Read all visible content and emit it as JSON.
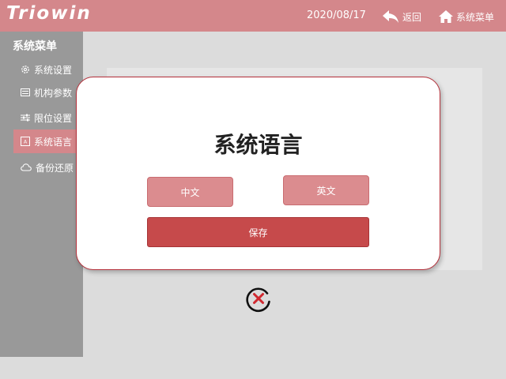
{
  "header": {
    "logo": "Triowin",
    "date": "2020/08/17",
    "back_label": "返回",
    "menu_label": "系统菜单"
  },
  "sidebar": {
    "title": "系统菜单",
    "items": [
      {
        "label": "系统设置",
        "icon": "gear-icon"
      },
      {
        "label": "机构参数",
        "icon": "list-icon"
      },
      {
        "label": "限位设置",
        "icon": "sliders-icon"
      },
      {
        "label": "系统语言",
        "icon": "language-icon",
        "active": true
      },
      {
        "label": "备份还原",
        "icon": "cloud-icon"
      }
    ]
  },
  "modal": {
    "title": "系统语言",
    "chinese_label": "中文",
    "english_label": "英文",
    "save_label": "保存"
  },
  "colors": {
    "header_bg": "#d4878b",
    "sidebar_bg": "#999999",
    "accent": "#c64a4b",
    "button_bg": "#db8c8f"
  }
}
